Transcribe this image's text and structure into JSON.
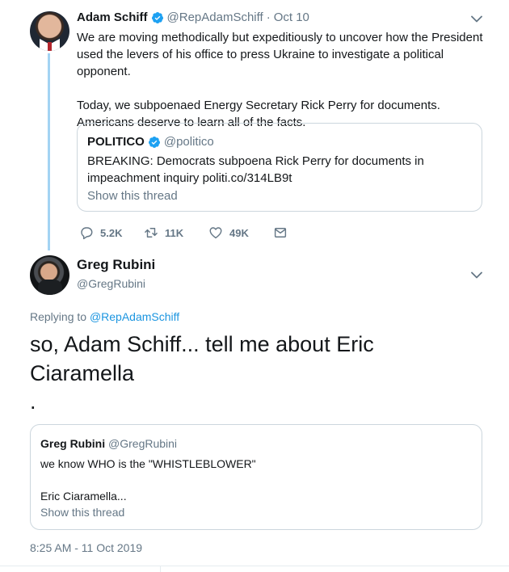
{
  "parent_tweet": {
    "author_name": "Adam Schiff",
    "handle": "@RepAdamSchiff",
    "separator": "·",
    "date": "Oct 10",
    "paragraphs": [
      "We are moving methodically but expeditiously to uncover how the President used the levers of his office to press Ukraine to investigate a political opponent.",
      "Today, we subpoenaed Energy Secretary Rick Perry for documents. Americans deserve to learn all of the facts."
    ],
    "quoted": {
      "author_name": "POLITICO",
      "handle": "@politico",
      "text": "BREAKING: Democrats subpoena Rick Perry for documents in impeachment inquiry politi.co/314LB9t",
      "show_thread": "Show this thread"
    },
    "actions": {
      "reply_icon": "reply-icon",
      "replies": "5.2K",
      "retweet_icon": "retweet-icon",
      "retweets": "11K",
      "like_icon": "heart-icon",
      "likes": "49K",
      "message_icon": "envelope-icon"
    },
    "verified_color": "#1da1f2"
  },
  "reply_tweet": {
    "author_name": "Greg Rubini",
    "handle": "@GregRubini",
    "replying_to_prefix": "Replying to",
    "replying_to_handle": "@RepAdamSchiff",
    "text": "so, Adam Schiff... tell me about Eric Ciaramella",
    "dot": ".",
    "quoted": {
      "author_name": "Greg Rubini",
      "handle": "@GregRubini",
      "lines": [
        "we know WHO is the \"WHISTLEBLOWER\"",
        "",
        "Eric Ciaramella..."
      ],
      "show_thread": "Show this thread"
    },
    "timestamp": "8:25 AM - 11 Oct 2019"
  },
  "colors": {
    "link": "#1b95e0",
    "muted": "#657786",
    "thread_line": "#a3d3f3",
    "border": "#ccd6dd"
  }
}
